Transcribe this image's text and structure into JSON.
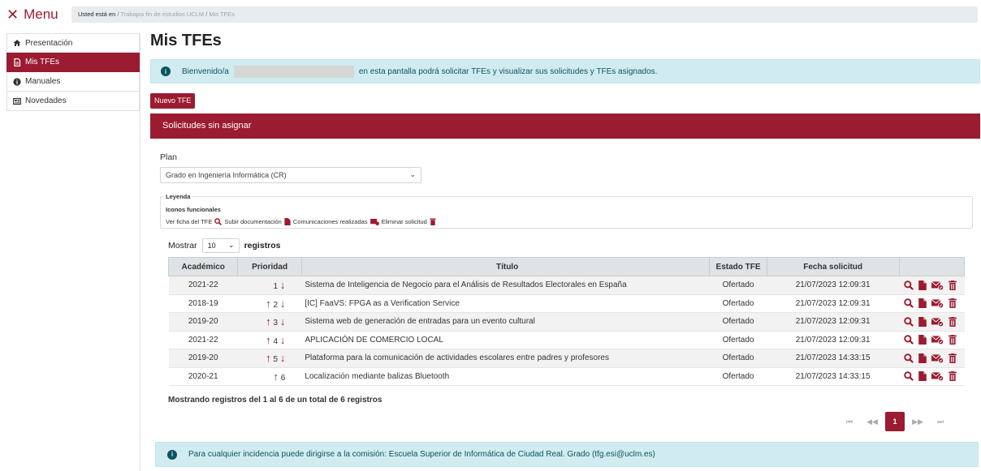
{
  "menu": {
    "close_glyph": "✕",
    "label": "Menu"
  },
  "breadcrumb": {
    "prefix": "Usted está en",
    "sep1": "/",
    "item1": "Trabajos fin de estudios UCLM",
    "sep2": "/",
    "item2": "Mis TFEs"
  },
  "sidebar": {
    "items": [
      {
        "label": "Presentación",
        "icon": "home-icon"
      },
      {
        "label": "Mis TFEs",
        "icon": "document-icon"
      },
      {
        "label": "Manuales",
        "icon": "info-circle-icon"
      },
      {
        "label": "Novedades",
        "icon": "newspaper-icon"
      }
    ]
  },
  "main": {
    "title": "Mis TFEs",
    "welcome_pre": "Bienvenido/a",
    "welcome_post": "en esta pantalla podrá solicitar TFEs y visualizar sus solicitudes y TFEs asignados.",
    "new_button": "Nuevo TFE",
    "card_title": "Solicitudes sin asignar",
    "plan_label": "Plan",
    "plan_value": "Grado en Ingeniería Informática (CR)",
    "legend": {
      "title": "Leyenda",
      "subtitle": "Iconos funcionales",
      "items": [
        "Ver ficha del TFE",
        "Subir documentación",
        "Comunicaciones realizadas",
        "Eliminar solicitud"
      ]
    },
    "show": {
      "pre": "Mostrar",
      "value": "10",
      "post": "registros"
    },
    "table": {
      "headers": [
        "Académico",
        "Prioridad",
        "Título",
        "Estado TFE",
        "Fecha solicitud",
        ""
      ],
      "rows": [
        {
          "academico": "2021-22",
          "prioridad": "1",
          "titulo": "Sistema de Inteligencia de Negocio para el Análisis de Resultados Electorales en España",
          "estado": "Ofertado",
          "fecha": "21/07/2023 12:09:31"
        },
        {
          "academico": "2018-19",
          "prioridad": "2",
          "titulo": "[IC] FaaVS: FPGA as a Verification Service",
          "estado": "Ofertado",
          "fecha": "21/07/2023 12:09:31"
        },
        {
          "academico": "2019-20",
          "prioridad": "3",
          "titulo": "Sistema web de generación de entradas para un evento cultural",
          "estado": "Ofertado",
          "fecha": "21/07/2023 12:09:31"
        },
        {
          "academico": "2021-22",
          "prioridad": "4",
          "titulo": "APLICACIÓN DE COMERCIO LOCAL",
          "estado": "Ofertado",
          "fecha": "21/07/2023 12:09:31"
        },
        {
          "academico": "2019-20",
          "prioridad": "5",
          "titulo": "Plataforma para la comunicación de actividades escolares entre padres y profesores",
          "estado": "Ofertado",
          "fecha": "21/07/2023 14:33:15"
        },
        {
          "academico": "2020-21",
          "prioridad": "6",
          "titulo": "Localización mediante balizas Bluetooth",
          "estado": "Ofertado",
          "fecha": "21/07/2023 14:33:15"
        }
      ]
    },
    "summary": "Mostrando registros del 1 al 6 de un total de 6 registros",
    "pager": {
      "first": "⏮",
      "prev": "◀◀",
      "current": "1",
      "next": "▶▶",
      "last": "⏭"
    },
    "footer_info": "Para cualquier incidencia puede dirigirse a la comisión: Escuela Superior de Informática de Ciudad Real. Grado (tfg.esi@uclm.es)"
  },
  "colors": {
    "brand": "#9b1b30",
    "info_bg": "#d1ecf1",
    "info_text": "#0c5460"
  }
}
